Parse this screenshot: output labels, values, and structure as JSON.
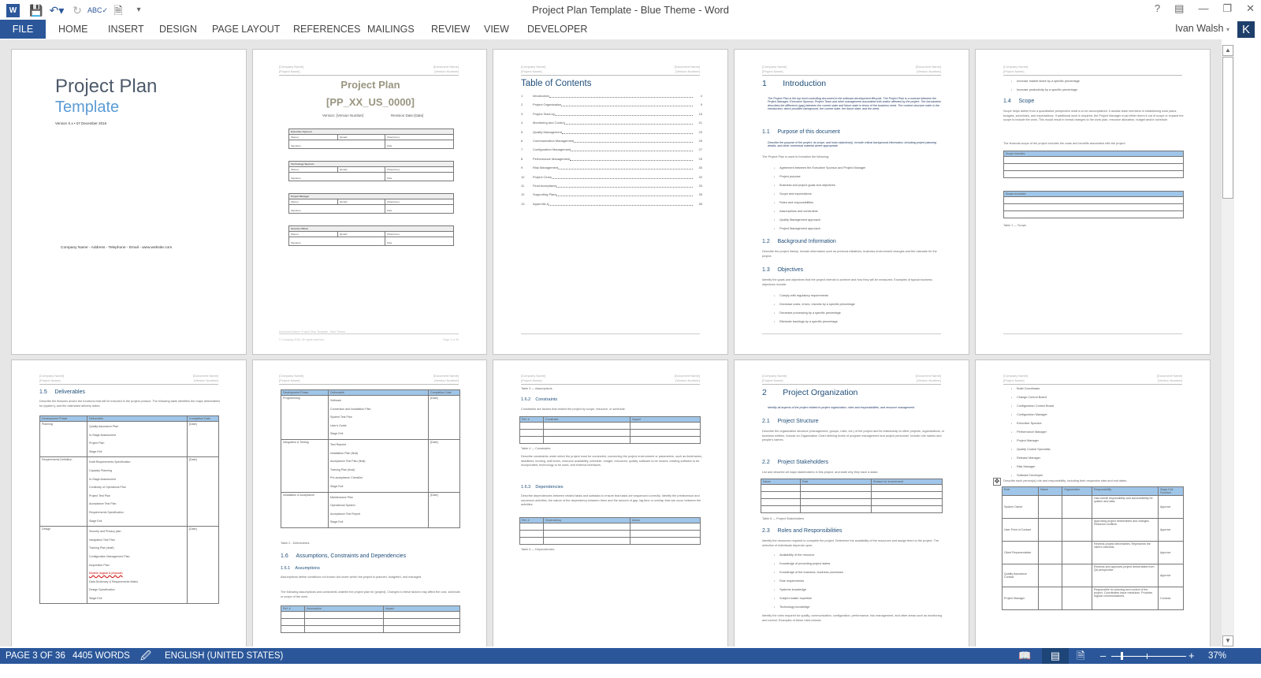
{
  "app": {
    "title": "Project Plan Template - Blue Theme - Word",
    "user": "Ivan Walsh",
    "user_initial": "K"
  },
  "qat": {
    "icons": [
      "word-logo",
      "save-icon",
      "undo-icon",
      "redo-icon",
      "spelling-icon",
      "print-preview-icon",
      "customize-qat-icon"
    ]
  },
  "window_controls": [
    "help-icon",
    "ribbon-display-icon",
    "minimize-icon",
    "restore-icon",
    "close-icon"
  ],
  "ribbon": {
    "tabs": [
      "FILE",
      "HOME",
      "INSERT",
      "DESIGN",
      "PAGE LAYOUT",
      "REFERENCES",
      "MAILINGS",
      "REVIEW",
      "VIEW",
      "DEVELOPER"
    ]
  },
  "status": {
    "page": "PAGE 3 OF 36",
    "words": "4405 WORDS",
    "language": "ENGLISH (UNITED STATES)",
    "zoom": "37%",
    "zoom_minus": "–",
    "zoom_plus": "+"
  },
  "doc_header": {
    "company": "[Company Name]",
    "project": "[Project Name]",
    "document": "[Document Name]",
    "version": "[Version Number]"
  },
  "doc_footer": {
    "docname": "Document Name: Project Plan Template - Blue Theme",
    "copyright": "© Company 2016. All rights reserved.",
    "page2": "Page 2 of 36"
  },
  "pages": {
    "cover": {
      "title": "Project Plan",
      "subtitle": "Template",
      "version": "Version X.x • 07 December 2016",
      "contact": "Company Name - Address - Telephone - Email - www.website.com"
    },
    "signoff": {
      "title": "Project Plan",
      "code": "[PP_XX_US_0000]",
      "version": "Version: [Version Number]",
      "revision": "Revision Date [Date]",
      "blocks": [
        {
          "role": "Executive Sponsor"
        },
        {
          "role": "Technology Sponsor"
        },
        {
          "role": "Project Manager"
        },
        {
          "role": "Security Officer"
        }
      ],
      "fields": {
        "name": "[Name]",
        "email": "[Email]",
        "telephone": "[Telephone]",
        "signature": "Signature",
        "date": "Date"
      }
    },
    "toc": {
      "title": "Table of Contents",
      "items": [
        {
          "n": "1",
          "label": "Introduction",
          "page": "4"
        },
        {
          "n": "2",
          "label": "Project Organization",
          "page": "9"
        },
        {
          "n": "3",
          "label": "Project Start-Up",
          "page": "15"
        },
        {
          "n": "4",
          "label": "Monitoring and Control",
          "page": "21"
        },
        {
          "n": "5",
          "label": "Quality Management",
          "page": "23"
        },
        {
          "n": "6",
          "label": "Communication Management",
          "page": "25"
        },
        {
          "n": "7",
          "label": "Configuration Management",
          "page": "27"
        },
        {
          "n": "8",
          "label": "Performance Management",
          "page": "29"
        },
        {
          "n": "9",
          "label": "Risk Management",
          "page": "30"
        },
        {
          "n": "10",
          "label": "Project Close",
          "page": "32"
        },
        {
          "n": "11",
          "label": "Final Acceptance",
          "page": "33"
        },
        {
          "n": "12",
          "label": "Supporting Plans",
          "page": "35"
        },
        {
          "n": "13",
          "label": "Appendix A",
          "page": "36"
        }
      ]
    },
    "intro": {
      "h1": "1       Introduction",
      "p1": "The Project Plan is the top level controlling document in the software development lifecycle. The Project Plan is a contract between the Project Manager, Executive Sponsor, Project Team and other management associated with and/or affected by the project. The Introduction describes the difference (gap) between the current state and future state in terms of the business need. The content structure order is the introduction, which provides background, the current state, the future state, and the need.",
      "h11": "1.1     Purpose of this document",
      "p11": "Describe the purpose of the project, its scope, and main objective(s). Include critical background information, including project planning details, and other contextual material where appropriate.",
      "p11b": "The Project Plan is used to formalize the following:",
      "list11": [
        "Agreement between the Executive Sponsor and Project Manager",
        "Project purpose",
        "Business and project goals and objectives",
        "Scope and expectations",
        "Roles and responsibilities",
        "Assumptions and constraints",
        "Quality Management approach",
        "Project Management approach"
      ],
      "h12": "1.2     Background Information",
      "p12": "Describe the project history. Include information such as previous initiatives, business environment changes and the rationale for the project.",
      "h13": "1.3     Objectives",
      "p13": "Identify the goals and objectives that the project intends to achieve and how they will be measured. Examples of typical business objectives include:",
      "list13": [
        "Comply with regulatory requirements",
        "Decrease costs, errors, reworks by a specific percentage",
        "Decrease processing by a specific percentage",
        "Eliminate backlogs by a specific percentage"
      ]
    },
    "scope": {
      "list": [
        "Increase market share by a specific percentage",
        "Increase productivity by a specific percentage"
      ],
      "h": "1.4     Scope",
      "p1": "Scope helps define from a quantitative perspective what is to be accomplished. It assists team members in establishing work plans, budgets, schedules, and expectations. If additional work is required, the Project Manager must either deem it out of scope or expand the scope to include the work. This would result in formal changes to the work plan, resource allocation, budget and/or schedule.",
      "p2": "The financial scope of the project includes the costs and benefits associated with the project.",
      "includes": "Scope includes",
      "excludes": "Scope excludes",
      "caption": "Table 1 — Scope"
    },
    "deliverables": {
      "h": "1.5     Deliverables",
      "p": "Describe the features and/or the functions that will be included in the project product. The following table identifies the major deliverables for [system], and the estimated delivery dates.",
      "headers": [
        "Development Phase",
        "Deliverable",
        "Completion Date"
      ],
      "rows": [
        {
          "phase": "Planning",
          "items": [
            "Quality Assurance Plan",
            "In-Stage Assessment",
            "Project Plan",
            "Stage Exit"
          ],
          "date": "[Date]"
        },
        {
          "phase": "Requirements Definition",
          "items": [
            "Draft Requirements Specification",
            "Capacity Planning",
            "In-Stage Assessment",
            "Continuity of Operations Plan",
            "Project Test Plan",
            "Acceptance Test Plan",
            "Requirements Specification",
            "Stage Exit"
          ],
          "date": "[Date]"
        },
        {
          "phase": "Design",
          "items": [
            "Security and Privacy plan",
            "Integration Test Plan",
            "Training Plan (draft)",
            "Configuration Management Plan",
            "Acquisition Plan",
            "Models (logical & physical)",
            "Data Dictionary & Requirements Matrix",
            "Design Specification",
            "Stage Exit"
          ],
          "date": "[Date]"
        }
      ]
    },
    "deliverables2": {
      "rows": [
        {
          "phase": "Programming",
          "items": [
            "Software",
            "Conversion and Installation Plan",
            "System Test Plan",
            "User's Guide",
            "Stage Exit"
          ],
          "date": "[Date]"
        },
        {
          "phase": "Integration & Testing",
          "items": [
            "Test Reports",
            "Installation Plan (final)",
            "Acceptance Test Plan (final)",
            "Training Plan (final)",
            "Pre-acceptance Checklist",
            "Stage Exit"
          ],
          "date": "[Date]"
        },
        {
          "phase": "Installation & Acceptance",
          "items": [
            "Maintenance Plan",
            "Operational System",
            "Acceptance Test Report",
            "Stage Exit"
          ],
          "date": "[Date]"
        }
      ],
      "caption": "Table 2 - Deliverables",
      "h16": "1.6     Assumptions, Constraints and Dependencies",
      "h161": "1.6.1    Assumptions",
      "p1": "Assumptions define conditions not known but under which the project is planned, budgeted, and managed.",
      "p2": "The following assumptions and constraints underlie the project plan for [project]. Changes to these factors may affect the cost, schedule, or scope of the work.",
      "headers": [
        "Ref. #",
        "Assumption",
        "Impact"
      ]
    },
    "constraints": {
      "cap3": "Table 3 — Assumptions",
      "h": "1.6.2    Constraints",
      "p": "Constraints are factors that restrict the project by scope, resource, or schedule.",
      "headers": [
        "Ref. #",
        "Constraint",
        "Impact"
      ],
      "cap4": "Table 4 — Constraints",
      "p2": "Describe constraints under which the project must be conducted, concerning the project environment or parameters, such as timeframes, deadlines, funding, skill levels, resource availability, schedule, budget, resources, quality, software to be reused, existing software to be incorporated, technology to be used, and external interfaces.",
      "h163": "1.6.3    Dependencies",
      "p3": "Describe dependencies between related tasks and subtasks to ensure that tasks are sequenced correctly. Identify the predecessor and successor activities, the nature of the dependency between them and the amount of gap, lag time or overlap that can occur between the activities.",
      "headers2": [
        "Ref. #",
        "Dependency",
        "Action"
      ],
      "cap5": "Table 5 — Dependencies"
    },
    "org": {
      "h": "2       Project Organization",
      "p": "Identify all aspects of the project related to project organization, roles and responsibilities, and resource management.",
      "h21": "2.1     Project Structure",
      "p21": "Describe the organization structure (management, groups, roles, etc.) of the project and its relationship to other projects, organizations, or business entities. Include an Organization Chart defining levels of program management and project personnel. Include role names and people's names.",
      "h22": "2.2     Project Stakeholders",
      "p22": "List and describe all major stakeholders in this project, and state why they have a stake.",
      "headers": [
        "Name",
        "Role",
        "Reason for involvement"
      ],
      "cap6": "Table 6 — Project Stakeholders",
      "h23": "2.3     Roles and Responsibilities",
      "p23": "Identify the resources required to complete the project. Determine the availability of the resources and assign them to the project. The selection of individuals depends upon:",
      "list": [
        "Availability of the resource",
        "Knowledge of preceding project states",
        "Knowledge of the business, business processes",
        "Role requirements",
        "Systems knowledge",
        "Subject matter expertise",
        "Technology knowledge"
      ],
      "p24": "Identify the roles required for quality, communication, configuration, performance, risk management, and other areas such as monitoring and control. Examples of these roles include:"
    },
    "roles": {
      "list": [
        "Build Coordinator",
        "Change Control Board",
        "Configuration Control Board",
        "Configuration Manager",
        "Executive Sponsor",
        "Performance Manager",
        "Project Manager",
        "Quality Control Specialist",
        "Release Manager",
        "Risk Manager",
        "Software Developer"
      ],
      "p": "Describe each person(s) role and responsibility, including their respective start and end dates.",
      "headers": [
        "Role",
        "Name",
        "Organization",
        "Responsibility",
        "Stage Exit Function"
      ],
      "rows": [
        {
          "role": "System Owner",
          "resp": "Has overall responsibility and accountability for system and data.",
          "fn": "Approve"
        },
        {
          "role": "User Point of Contact",
          "resp": "Approving project deliverables and changes. Resolves conflicts.",
          "fn": "Approve"
        },
        {
          "role": "Client Representative",
          "resp": "Reviews project deliverables. Represents the client's interests.",
          "fn": "Approve"
        },
        {
          "role": "Quality Assurance Contact",
          "resp": "Reviews and approves project deliverables from QA perspective.",
          "fn": "Approve"
        },
        {
          "role": "Project Manager",
          "resp": "Responsible for planning and control of the project. Coordinates issue resolution. Provides regular communications.",
          "fn": "Conduct"
        }
      ]
    }
  }
}
